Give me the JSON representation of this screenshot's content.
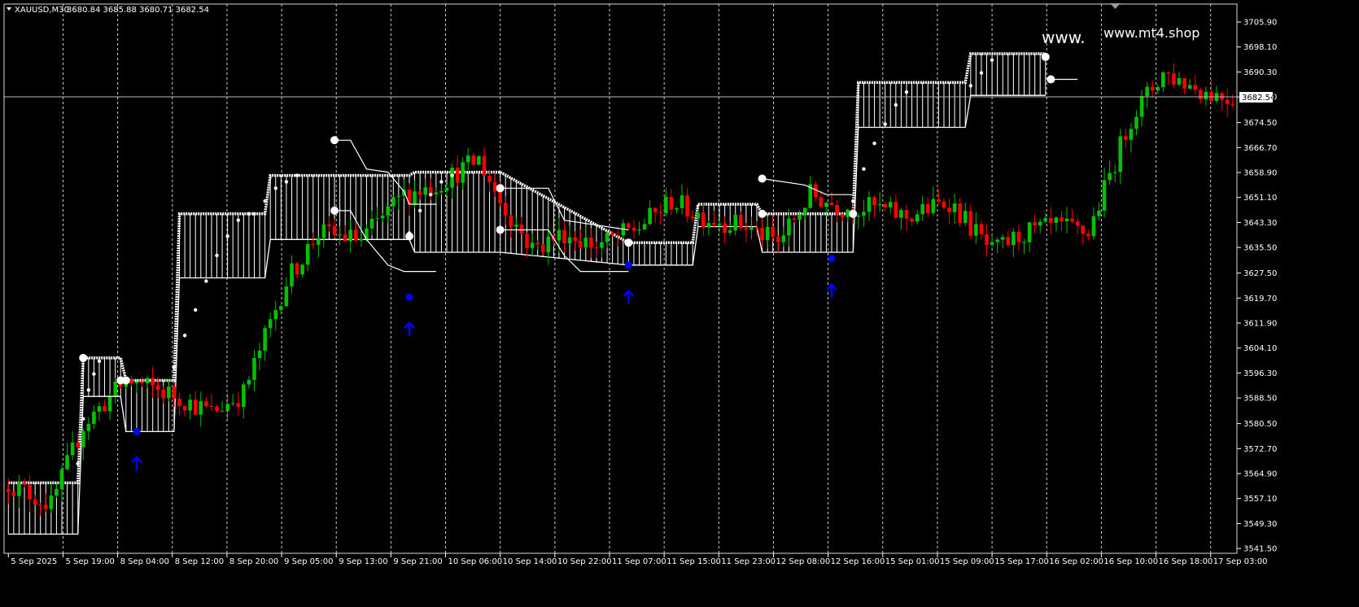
{
  "header": {
    "symbol": "XAUUSD,M30",
    "ohlc": "3680.84 3685.88 3680.71 3682.54"
  },
  "watermark": {
    "left": "www.",
    "right": "www.mt4.shop"
  },
  "colors": {
    "bull": "#00c000",
    "bear": "#ff0000",
    "band": "#ffffff",
    "arrow": "#0000ff",
    "grid": "#cfcfcf",
    "bg": "#000000"
  },
  "chart_data": {
    "type": "candlestick",
    "current_price": "3682.54",
    "ylim": [
      3540.0,
      3711.5
    ],
    "y_ticks": [
      "3705.90",
      "3698.10",
      "3690.30",
      "3682.50",
      "3674.50",
      "3666.70",
      "3658.90",
      "3651.10",
      "3643.30",
      "3635.50",
      "3627.50",
      "3619.70",
      "3611.90",
      "3604.10",
      "3596.30",
      "3588.50",
      "3580.50",
      "3572.70",
      "3564.90",
      "3557.10",
      "3549.30",
      "3541.50"
    ],
    "x_ticks": [
      "5 Sep 2025",
      "5 Sep 19:00",
      "8 Sep 04:00",
      "8 Sep 12:00",
      "8 Sep 20:00",
      "9 Sep 05:00",
      "9 Sep 13:00",
      "9 Sep 21:00",
      "10 Sep 06:00",
      "10 Sep 14:00",
      "10 Sep 22:00",
      "11 Sep 07:00",
      "11 Sep 15:00",
      "11 Sep 23:00",
      "12 Sep 08:00",
      "12 Sep 16:00",
      "15 Sep 01:00",
      "15 Sep 09:00",
      "15 Sep 17:00",
      "16 Sep 02:00",
      "16 Sep 10:00",
      "16 Sep 18:00",
      "17 Sep 03:00"
    ],
    "bars_count": 230,
    "close_anchors": [
      [
        0,
        3562
      ],
      [
        8,
        3555
      ],
      [
        14,
        3580
      ],
      [
        22,
        3594
      ],
      [
        30,
        3590
      ],
      [
        38,
        3584
      ],
      [
        44,
        3590
      ],
      [
        52,
        3625
      ],
      [
        58,
        3640
      ],
      [
        66,
        3638
      ],
      [
        74,
        3652
      ],
      [
        80,
        3655
      ],
      [
        88,
        3663
      ],
      [
        92,
        3650
      ],
      [
        98,
        3635
      ],
      [
        104,
        3640
      ],
      [
        110,
        3636
      ],
      [
        118,
        3642
      ],
      [
        124,
        3650
      ],
      [
        130,
        3645
      ],
      [
        138,
        3642
      ],
      [
        144,
        3637
      ],
      [
        150,
        3652
      ],
      [
        156,
        3648
      ],
      [
        162,
        3648
      ],
      [
        168,
        3645
      ],
      [
        176,
        3650
      ],
      [
        184,
        3634
      ],
      [
        190,
        3640
      ],
      [
        196,
        3642
      ],
      [
        202,
        3640
      ],
      [
        210,
        3676
      ],
      [
        216,
        3690
      ],
      [
        224,
        3684
      ],
      [
        229,
        3682
      ]
    ],
    "support_band": [
      [
        0,
        3562,
        3546
      ],
      [
        13,
        3562,
        3546
      ],
      [
        14,
        3601,
        3589
      ],
      [
        21,
        3601,
        3589
      ],
      [
        22,
        3594,
        3578
      ],
      [
        31,
        3594,
        3578
      ],
      [
        32,
        3646,
        3626
      ],
      [
        48,
        3646,
        3626
      ],
      [
        49,
        3658,
        3638
      ],
      [
        60,
        3658,
        3638
      ],
      [
        75,
        3658,
        3638
      ],
      [
        76,
        3659,
        3634
      ],
      [
        92,
        3659,
        3634
      ],
      [
        116,
        3637,
        3630
      ],
      [
        128,
        3637,
        3630
      ],
      [
        129,
        3649,
        3642
      ],
      [
        140,
        3649,
        3642
      ],
      [
        141,
        3646,
        3634
      ],
      [
        158,
        3646,
        3634
      ],
      [
        159,
        3687,
        3673
      ],
      [
        179,
        3687,
        3673
      ],
      [
        180,
        3696,
        3683
      ],
      [
        194,
        3696,
        3683
      ]
    ],
    "resistance_lines": [
      [
        [
          61,
          3669
        ],
        [
          64,
          3669
        ],
        [
          67,
          3660
        ],
        [
          71,
          3659
        ],
        [
          74,
          3653
        ],
        [
          75,
          3649
        ],
        [
          80,
          3649
        ]
      ],
      [
        [
          61,
          3647
        ],
        [
          64,
          3647
        ],
        [
          67,
          3638
        ],
        [
          71,
          3630
        ],
        [
          74,
          3628
        ],
        [
          80,
          3628
        ]
      ],
      [
        [
          14,
          3589
        ],
        [
          21,
          3589
        ]
      ],
      [
        [
          92,
          3654
        ],
        [
          101,
          3654
        ],
        [
          104,
          3644
        ],
        [
          116,
          3641
        ]
      ],
      [
        [
          92,
          3641
        ],
        [
          101,
          3641
        ],
        [
          104,
          3633
        ],
        [
          107,
          3628
        ],
        [
          116,
          3628
        ]
      ],
      [
        [
          141,
          3657
        ],
        [
          149,
          3655
        ],
        [
          153,
          3652
        ],
        [
          158,
          3652
        ]
      ],
      [
        [
          195,
          3688
        ],
        [
          200,
          3688
        ]
      ]
    ],
    "support_dots": [
      [
        [
          13,
          3568
        ],
        [
          14,
          3582
        ],
        [
          15,
          3591
        ],
        [
          16,
          3596
        ],
        [
          17,
          3600
        ]
      ],
      [
        [
          31,
          3598
        ],
        [
          33,
          3608
        ],
        [
          35,
          3616
        ],
        [
          37,
          3625
        ],
        [
          39,
          3633
        ],
        [
          41,
          3639
        ],
        [
          43,
          3644
        ],
        [
          45,
          3646
        ]
      ],
      [
        [
          46,
          3646
        ],
        [
          48,
          3650
        ],
        [
          50,
          3654
        ],
        [
          52,
          3656
        ],
        [
          54,
          3658
        ]
      ],
      [
        [
          75,
          3640
        ],
        [
          77,
          3647
        ],
        [
          79,
          3652
        ],
        [
          81,
          3656
        ],
        [
          83,
          3658
        ]
      ],
      [
        [
          158,
          3650
        ],
        [
          160,
          3660
        ],
        [
          162,
          3668
        ],
        [
          164,
          3674
        ],
        [
          166,
          3680
        ],
        [
          168,
          3684
        ]
      ],
      [
        [
          180,
          3686
        ],
        [
          182,
          3690
        ],
        [
          184,
          3694
        ]
      ]
    ],
    "markers": [
      [
        14,
        3601
      ],
      [
        21,
        3594
      ],
      [
        22,
        3594
      ],
      [
        61,
        3669
      ],
      [
        61,
        3647
      ],
      [
        75,
        3639
      ],
      [
        92,
        3654
      ],
      [
        92,
        3641
      ],
      [
        116,
        3637
      ],
      [
        141,
        3657
      ],
      [
        141,
        3646
      ],
      [
        158,
        3646
      ],
      [
        194,
        3695
      ],
      [
        195,
        3688
      ]
    ],
    "signals": [
      [
        24,
        3578
      ],
      [
        75,
        3620
      ],
      [
        116,
        3630
      ],
      [
        154,
        3632
      ]
    ]
  }
}
